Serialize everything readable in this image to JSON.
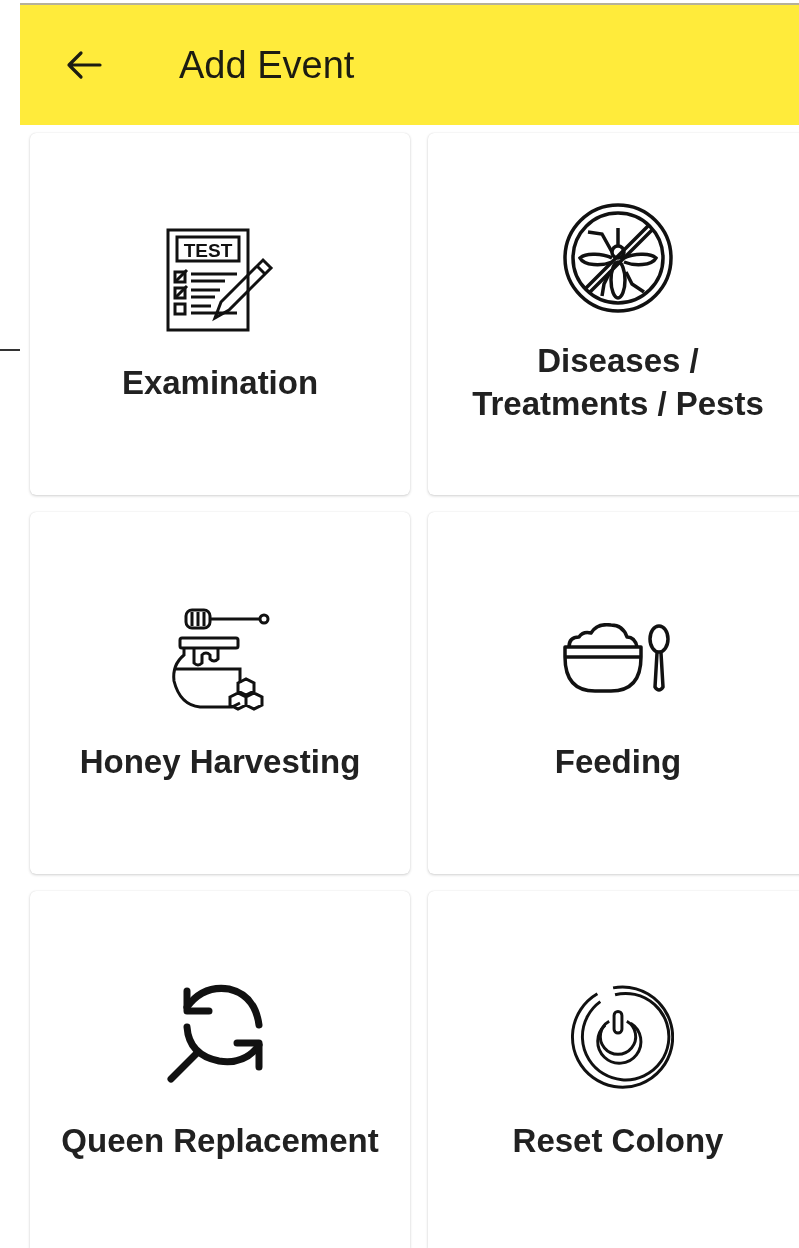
{
  "app_bar": {
    "title": "Add Event"
  },
  "events": [
    {
      "kind": "examination",
      "label": "Examination",
      "icon_text": "TEST"
    },
    {
      "kind": "diseases",
      "label": "Diseases / Treatments / Pests"
    },
    {
      "kind": "honey",
      "label": "Honey Harvesting"
    },
    {
      "kind": "feeding",
      "label": "Feeding"
    },
    {
      "kind": "queen",
      "label": "Queen Replacement"
    },
    {
      "kind": "reset",
      "label": "Reset Colony"
    }
  ]
}
